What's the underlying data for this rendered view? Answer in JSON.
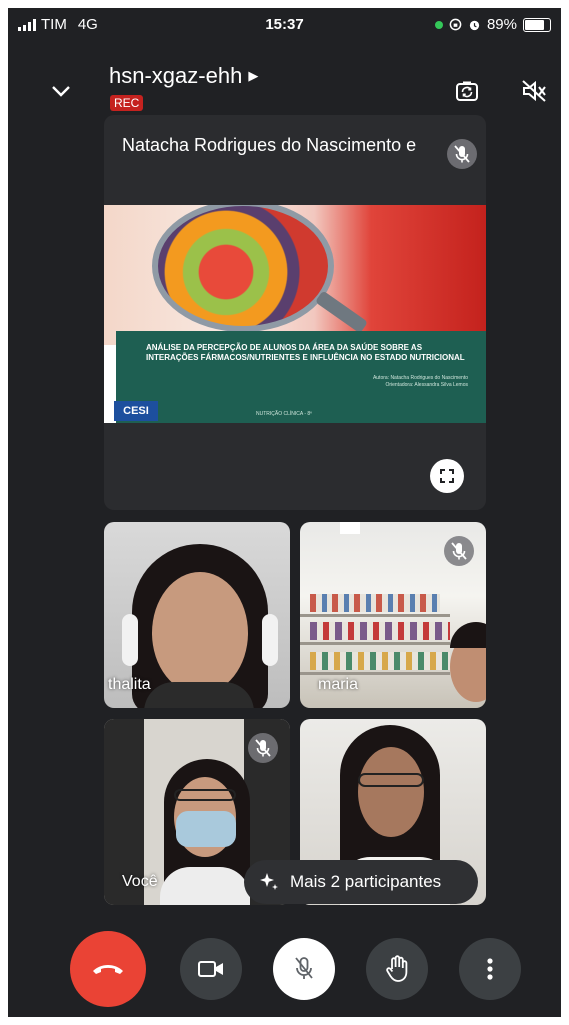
{
  "status_bar": {
    "carrier": "TIM",
    "network": "4G",
    "time": "15:37",
    "battery": "89%",
    "battery_level": 0.89
  },
  "meeting": {
    "code": "hsn-xgaz-ehh",
    "recording_badge": "REC"
  },
  "presentation": {
    "presenter_name": "Natacha Rodrigues do Nascimento e",
    "slide": {
      "title": "ANÁLISE DA PERCEPÇÃO DE ALUNOS DA ÁREA DA SAÚDE SOBRE AS INTERAÇÕES FÁRMACOS/NUTRIENTES E INFLUÊNCIA NO ESTADO NUTRICIONAL",
      "author_line_1": "Autora: Natacha Rodrigues do Nascimento",
      "author_line_2": "Orientadora: Alessandra Silva Lemos",
      "footer": "NUTRIÇÃO CLÍNICA - 8º",
      "logo": "CESI"
    }
  },
  "participants": [
    {
      "name": "thalita",
      "muted": false
    },
    {
      "name": "maria",
      "muted": true
    },
    {
      "name": "Você",
      "muted": true
    },
    {
      "name": "",
      "muted": false
    }
  ],
  "more_participants_label": "Mais 2 participantes",
  "icons": {
    "header": [
      "chevron-down-icon",
      "camera-switch-icon",
      "speaker-off-icon"
    ],
    "controls": [
      "end-call-icon",
      "camera-icon",
      "mic-off-icon",
      "raise-hand-icon",
      "more-options-icon"
    ]
  },
  "colors": {
    "background": "#202124",
    "end_call": "#ea4335",
    "rec_badge": "#c5221f",
    "control": "#3c4043"
  }
}
